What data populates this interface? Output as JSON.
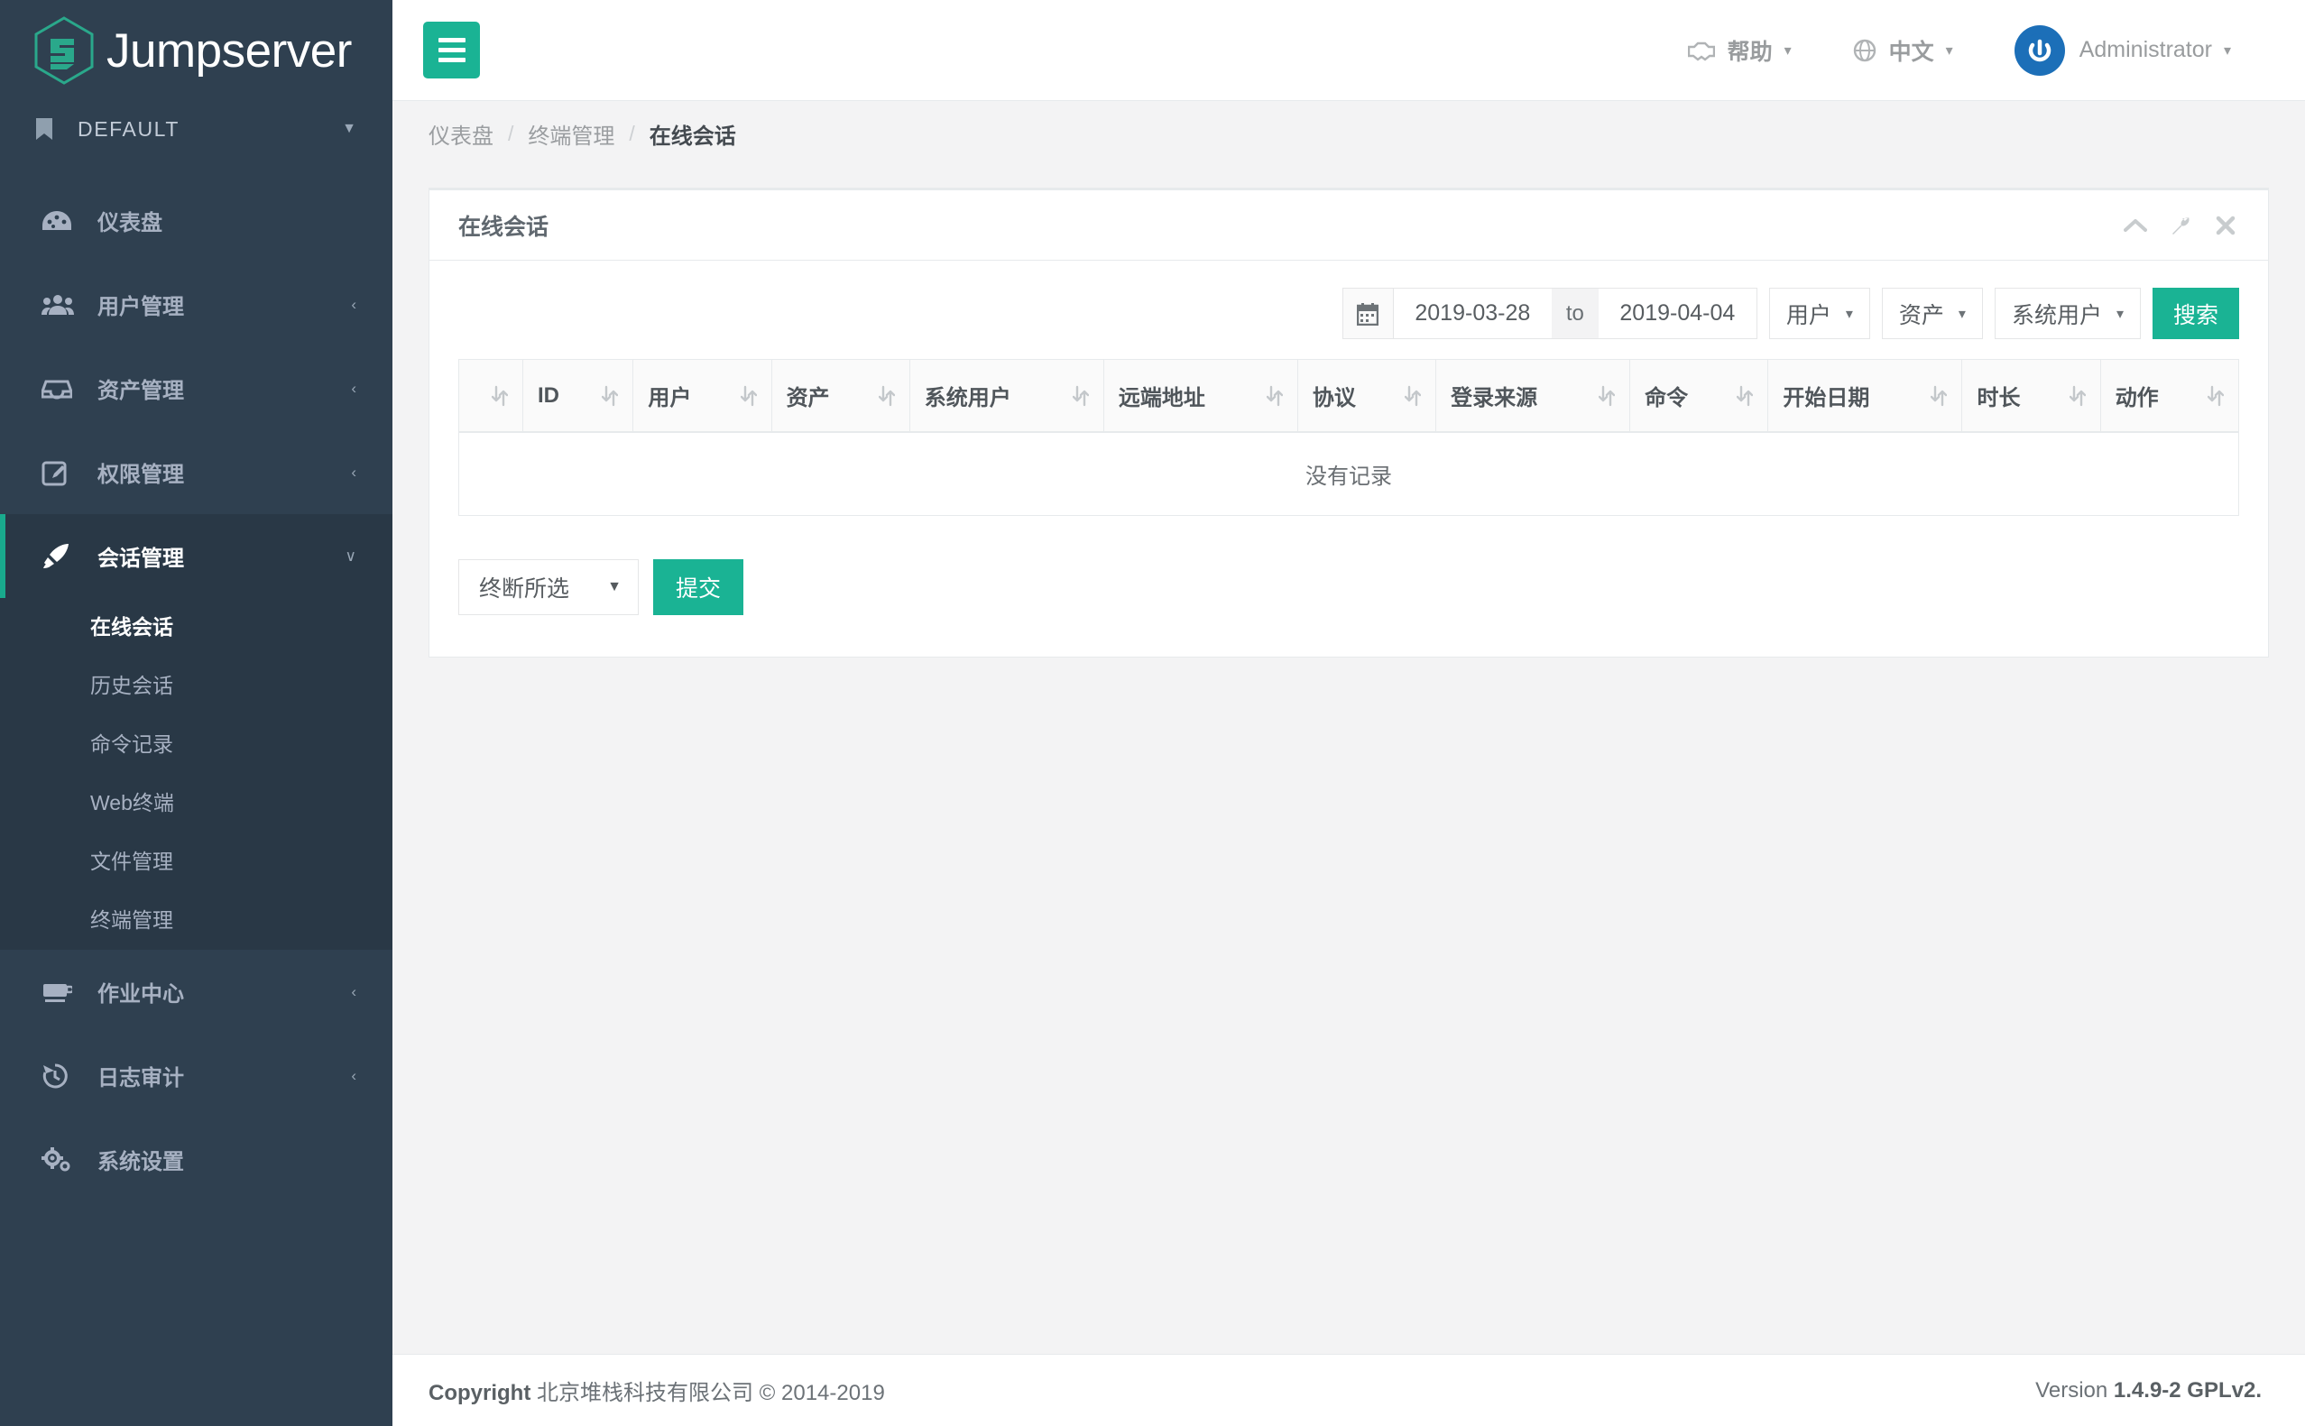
{
  "brand": {
    "name": "Jumpserver",
    "logo_icon": "jumpserver-logo-icon"
  },
  "org": {
    "label": "DEFAULT",
    "icon": "bookmark-icon",
    "caret": "▼"
  },
  "sidebar": {
    "items": [
      {
        "label": "仪表盘",
        "icon": "dashboard-icon",
        "arrow": ""
      },
      {
        "label": "用户管理",
        "icon": "users-icon",
        "arrow": "‹"
      },
      {
        "label": "资产管理",
        "icon": "inbox-icon",
        "arrow": "‹"
      },
      {
        "label": "权限管理",
        "icon": "edit-icon",
        "arrow": "‹"
      },
      {
        "label": "会话管理",
        "icon": "rocket-icon",
        "arrow": "∨"
      },
      {
        "label": "作业中心",
        "icon": "desktop-icon",
        "arrow": "‹"
      },
      {
        "label": "日志审计",
        "icon": "history-icon",
        "arrow": "‹"
      },
      {
        "label": "系统设置",
        "icon": "gears-icon",
        "arrow": ""
      }
    ],
    "submenu": [
      {
        "label": "在线会话"
      },
      {
        "label": "历史会话"
      },
      {
        "label": "命令记录"
      },
      {
        "label": "Web终端"
      },
      {
        "label": "文件管理"
      },
      {
        "label": "终端管理"
      }
    ]
  },
  "topbar": {
    "menu_icon": "hamburger-icon",
    "help": {
      "label": "帮助",
      "icon": "handshake-icon",
      "caret": "▾"
    },
    "language": {
      "label": "中文",
      "icon": "globe-icon",
      "caret": "▾"
    },
    "user": {
      "label": "Administrator",
      "icon": "power-avatar-icon",
      "caret": "▾"
    }
  },
  "breadcrumb": {
    "items": [
      {
        "label": "仪表盘"
      },
      {
        "label": "终端管理"
      },
      {
        "label": "在线会话"
      }
    ],
    "separator": "/"
  },
  "panel": {
    "title": "在线会话",
    "tools": [
      {
        "name": "collapse-icon"
      },
      {
        "name": "wrench-icon"
      },
      {
        "name": "close-icon"
      }
    ]
  },
  "filters": {
    "calendar_icon": "calendar-icon",
    "date_from": "2019-03-28",
    "date_to": "2019-04-04",
    "to_label": "to",
    "dropdowns": [
      {
        "label": "用户",
        "caret": "▾"
      },
      {
        "label": "资产",
        "caret": "▾"
      },
      {
        "label": "系统用户",
        "caret": "▾"
      }
    ],
    "search_label": "搜索"
  },
  "table": {
    "columns": [
      {
        "label": "",
        "sortable": true
      },
      {
        "label": "ID",
        "sortable": true
      },
      {
        "label": "用户",
        "sortable": true
      },
      {
        "label": "资产",
        "sortable": true
      },
      {
        "label": "系统用户",
        "sortable": true
      },
      {
        "label": "远端地址",
        "sortable": true
      },
      {
        "label": "协议",
        "sortable": true
      },
      {
        "label": "登录来源",
        "sortable": true
      },
      {
        "label": "命令",
        "sortable": true
      },
      {
        "label": "开始日期",
        "sortable": true
      },
      {
        "label": "时长",
        "sortable": true
      },
      {
        "label": "动作",
        "sortable": true
      }
    ],
    "rows": [],
    "empty_text": "没有记录"
  },
  "bulk": {
    "select_value": "终断所选",
    "caret": "▼",
    "submit_label": "提交"
  },
  "footer": {
    "copyright_prefix": "Copyright",
    "copyright_text": "北京堆栈科技有限公司 © 2014-2019",
    "version_prefix": "Version",
    "version_value": "1.4.9-2 GPLv2."
  },
  "colors": {
    "accent": "#1ab394",
    "sidebar_bg": "#2f4050",
    "sidebar_active_bg": "#293846",
    "page_bg": "#f3f3f4"
  }
}
